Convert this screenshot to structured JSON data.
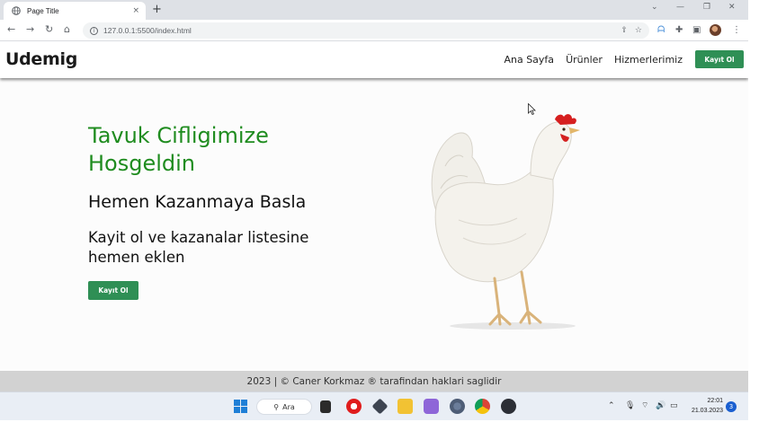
{
  "browser": {
    "tab_title": "Page Title",
    "tab_close": "×",
    "new_tab": "+",
    "url": "127.0.0.1:5500/index.html",
    "nav": {
      "back": "←",
      "forward": "→",
      "reload": "↻",
      "home": "⌂"
    }
  },
  "site": {
    "brand": "Udemig",
    "nav_links": [
      "Ana Sayfa",
      "Ürünler",
      "Hizmerlerimiz"
    ],
    "nav_button": "Kayıt Ol",
    "hero_title": "Tavuk Cifligimize Hosgeldin",
    "hero_subtitle": "Hemen Kazanmaya Basla",
    "hero_text": "Kayit ol ve kazanalar listesine hemen eklen",
    "hero_button": "Kayıt Ol",
    "footer": "2023 | © Caner Korkmaz ® tarafindan haklari saglidir"
  },
  "taskbar": {
    "search_label": "Ara",
    "time": "22:01",
    "date": "21.03.2023",
    "notification_count": "3"
  },
  "colors": {
    "accent_green": "#2f8f55",
    "title_green": "#1f8c1f",
    "footer_bg": "#d2d2d2"
  }
}
